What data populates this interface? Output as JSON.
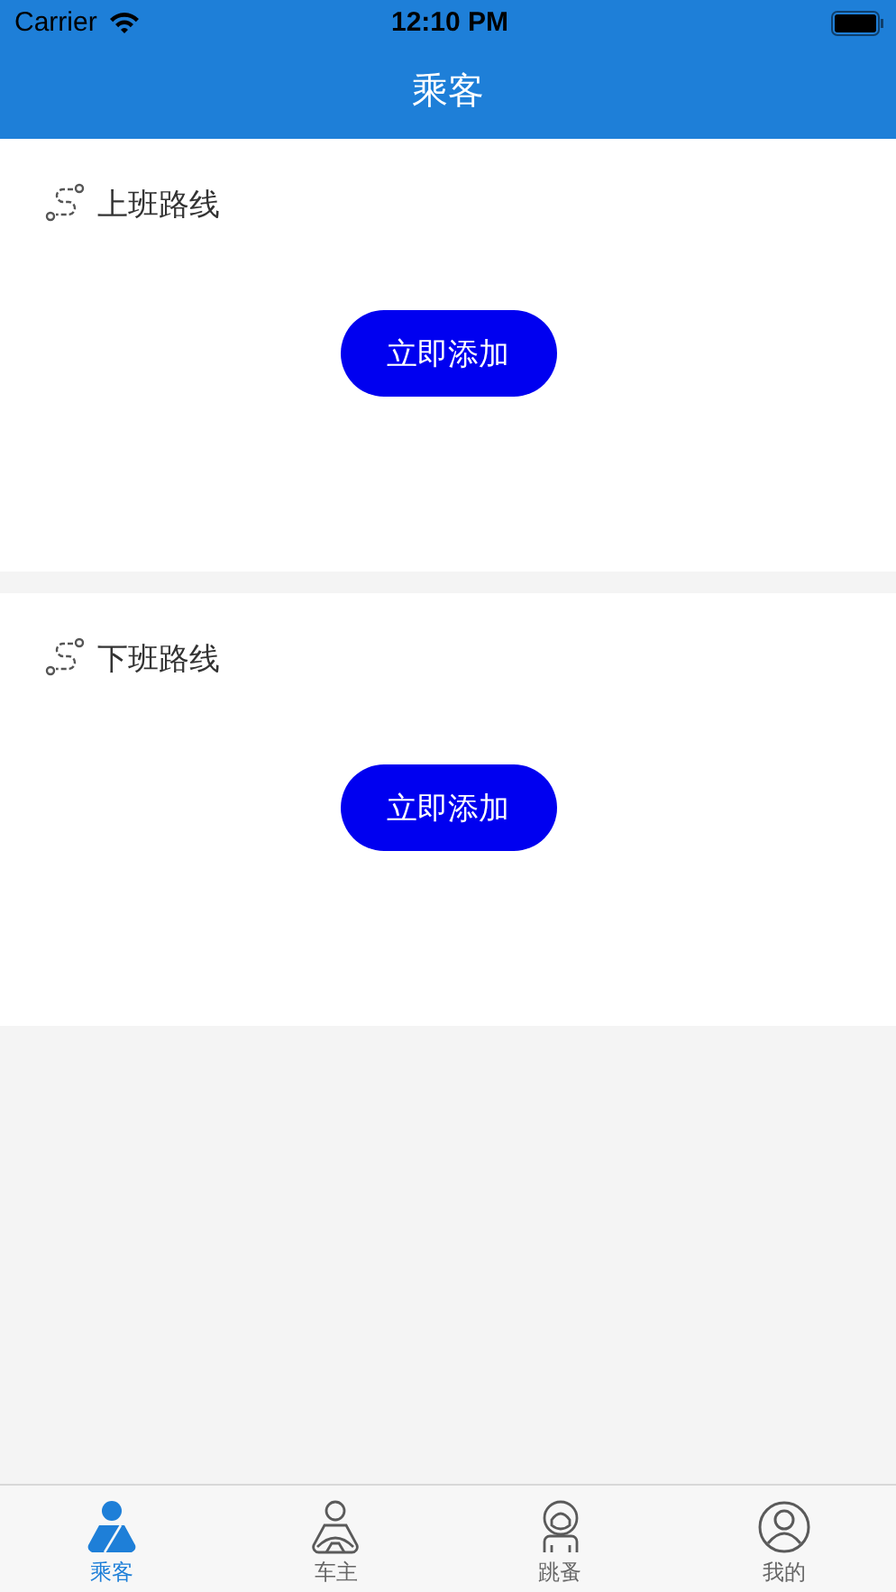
{
  "status_bar": {
    "carrier": "Carrier",
    "time": "12:10 PM"
  },
  "nav_bar": {
    "title": "乘客"
  },
  "routes": [
    {
      "title": "上班路线",
      "button": "立即添加"
    },
    {
      "title": "下班路线",
      "button": "立即添加"
    }
  ],
  "tab_bar": [
    {
      "kind": "passenger",
      "label": "乘客",
      "selected": true
    },
    {
      "kind": "driver",
      "label": "车主",
      "selected": false
    },
    {
      "kind": "flea",
      "label": "跳蚤",
      "selected": false
    },
    {
      "kind": "profile",
      "label": "我的",
      "selected": false
    }
  ]
}
